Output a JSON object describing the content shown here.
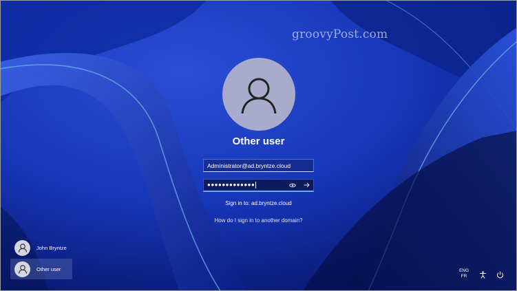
{
  "watermark": "groovyPost.com",
  "login": {
    "selected_user": "Other user",
    "username_value": "Administrator@ad.bryntze.cloud",
    "password_masked": "●●●●●●●●●●●●●",
    "sign_in_to": "Sign in to: ad.bryntze.cloud",
    "help_link": "How do I sign in to another domain?"
  },
  "users": [
    {
      "name": "John Bryntze",
      "selected": false
    },
    {
      "name": "Other user",
      "selected": true
    }
  ],
  "tray": {
    "lang_primary": "ENG",
    "lang_secondary": "FR",
    "icons": [
      "accessibility-icon",
      "power-icon"
    ]
  },
  "colors": {
    "background": "#0a1d6e",
    "accent": "#6ea8ff",
    "avatar": "#a8abcc"
  }
}
